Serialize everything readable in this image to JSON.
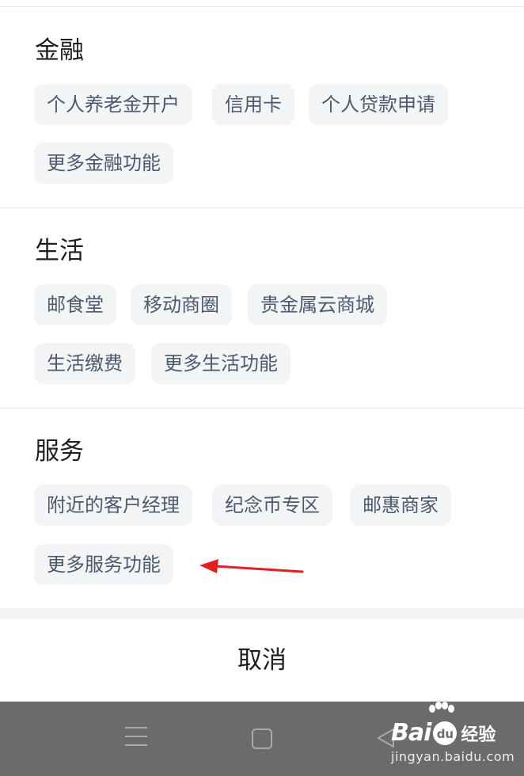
{
  "sections": [
    {
      "title": "金融",
      "chips": [
        "个人养老金开户",
        "信用卡",
        "个人贷款申请",
        "更多金融功能"
      ]
    },
    {
      "title": "生活",
      "chips": [
        "邮食堂",
        "移动商圈",
        "贵金属云商城",
        "生活缴费",
        "更多生活功能"
      ]
    },
    {
      "title": "服务",
      "chips": [
        "附近的客户经理",
        "纪念币专区",
        "邮惠商家",
        "更多服务功能"
      ]
    }
  ],
  "cancel_label": "取消",
  "nav_icons": [
    "menu-icon",
    "home-icon",
    "back-icon"
  ],
  "watermark": {
    "brand_bai": "Bai",
    "brand_du": "du",
    "brand_jingyan": "经验",
    "url": "jingyan.baidu.com"
  },
  "colors": {
    "chip_bg": "#f3f4f6",
    "chip_text": "#4d5a6d",
    "title_text": "#1e1e1e",
    "nav_bar": "#6b6b6b",
    "annotation_arrow": "#e02020"
  }
}
